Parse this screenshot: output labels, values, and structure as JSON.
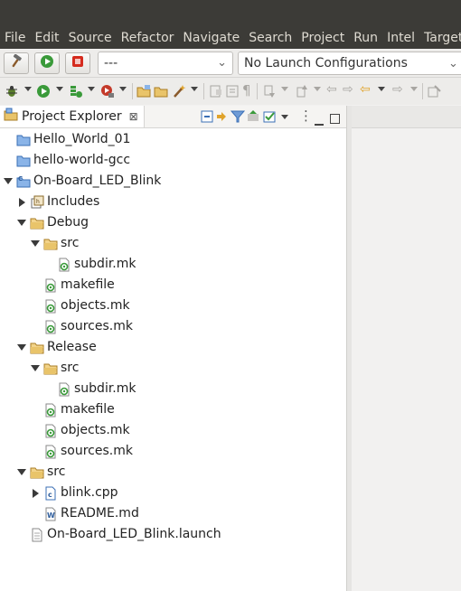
{
  "menubar": {
    "items": [
      "File",
      "Edit",
      "Source",
      "Refactor",
      "Navigate",
      "Search",
      "Project",
      "Run",
      "Intel",
      "Target"
    ]
  },
  "toolbar": {
    "config_value": "---",
    "launch_config": "No Launch Configurations"
  },
  "view": {
    "title": "Project Explorer",
    "close_glyph": "⊠"
  },
  "tree": [
    {
      "label": "Hello_World_01",
      "icon": "project-closed-icon"
    },
    {
      "label": "hello-world-gcc",
      "icon": "project-closed-icon"
    },
    {
      "label": "On-Board_LED_Blink",
      "icon": "cpp-project-icon",
      "expanded": true
    },
    {
      "label": "Includes",
      "icon": "includes-icon",
      "expanded": false
    },
    {
      "label": "Debug",
      "icon": "folder-icon",
      "expanded": true
    },
    {
      "label": "src",
      "icon": "folder-icon",
      "expanded": true
    },
    {
      "label": "subdir.mk",
      "icon": "make-file-icon"
    },
    {
      "label": "makefile",
      "icon": "make-file-icon"
    },
    {
      "label": "objects.mk",
      "icon": "make-file-icon"
    },
    {
      "label": "sources.mk",
      "icon": "make-file-icon"
    },
    {
      "label": "Release",
      "icon": "folder-icon",
      "expanded": true
    },
    {
      "label": "src",
      "icon": "folder-icon",
      "expanded": true
    },
    {
      "label": "subdir.mk",
      "icon": "make-file-icon"
    },
    {
      "label": "makefile",
      "icon": "make-file-icon"
    },
    {
      "label": "objects.mk",
      "icon": "make-file-icon"
    },
    {
      "label": "sources.mk",
      "icon": "make-file-icon"
    },
    {
      "label": "src",
      "icon": "folder-icon",
      "expanded": true
    },
    {
      "label": "blink.cpp",
      "icon": "cpp-file-icon",
      "expanded": false
    },
    {
      "label": "README.md",
      "icon": "text-doc-icon"
    },
    {
      "label": "On-Board_LED_Blink.launch",
      "icon": "launch-file-icon"
    }
  ]
}
